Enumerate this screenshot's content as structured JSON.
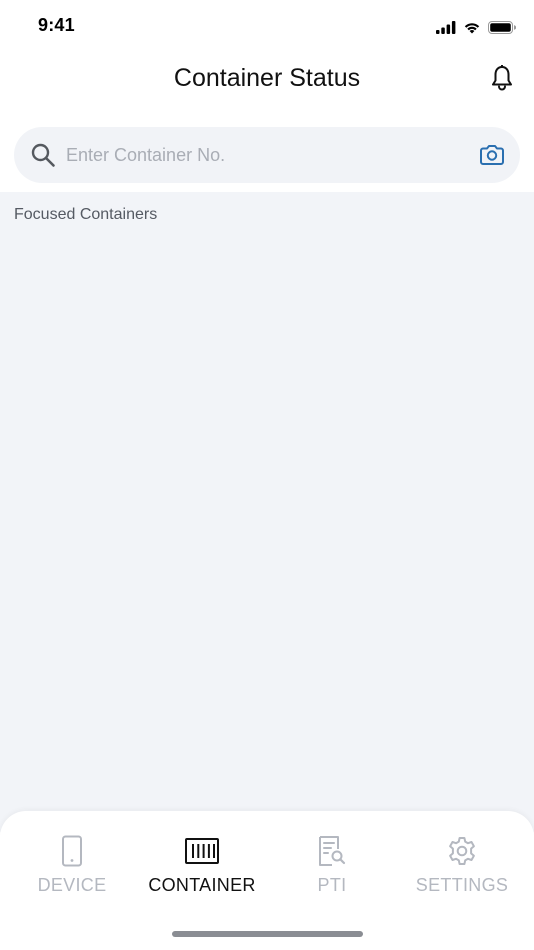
{
  "status_bar": {
    "time": "9:41",
    "icons": [
      "cellular-signal-icon",
      "wifi-icon",
      "battery-icon"
    ]
  },
  "header": {
    "title": "Container Status",
    "right_icon": "bell-icon"
  },
  "search": {
    "placeholder": "Enter Container No.",
    "value": "",
    "left_icon": "search-icon",
    "right_icon": "camera-icon"
  },
  "main": {
    "section_label": "Focused Containers"
  },
  "tab_bar": {
    "tabs": [
      {
        "label": "DEVICE",
        "icon": "phone-icon",
        "active": false
      },
      {
        "label": "CONTAINER",
        "icon": "container-icon",
        "active": true
      },
      {
        "label": "PTI",
        "icon": "document-search-icon",
        "active": false
      },
      {
        "label": "SETTINGS",
        "icon": "gear-icon",
        "active": false
      }
    ]
  },
  "colors": {
    "accent": "#2a6fb0",
    "inactive_tab": "#b4b8c0",
    "active_tab": "#111111",
    "content_bg": "#f2f4f8",
    "search_bg": "#f1f3f7"
  }
}
